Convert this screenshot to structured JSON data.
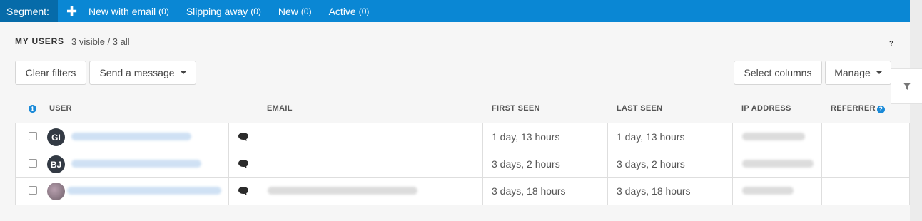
{
  "segment_bar": {
    "label": "Segment:",
    "add_symbol": "✚",
    "items": [
      {
        "label": "New with email",
        "count": "(0)"
      },
      {
        "label": "Slipping away",
        "count": "(0)"
      },
      {
        "label": "New",
        "count": "(0)"
      },
      {
        "label": "Active",
        "count": "(0)"
      }
    ]
  },
  "header": {
    "title": "MY USERS",
    "visible_count": "3 visible / 3 all",
    "help": "?"
  },
  "toolbar": {
    "clear_filters": "Clear filters",
    "send_message": "Send a message",
    "select_columns": "Select columns",
    "manage": "Manage"
  },
  "table": {
    "info_symbol": "i",
    "columns": {
      "user": "USER",
      "email": "EMAIL",
      "first_seen": "FIRST SEEN",
      "last_seen": "LAST SEEN",
      "ip_address": "IP ADDRESS",
      "referrer": "REFERRER",
      "referrer_help": "?"
    },
    "rows": [
      {
        "initials": "GI",
        "first_seen": "1 day, 13 hours",
        "last_seen": "1 day, 13 hours"
      },
      {
        "initials": "BJ",
        "first_seen": "3 days, 2 hours",
        "last_seen": "3 days, 2 hours"
      },
      {
        "initials": "",
        "first_seen": "3 days, 18 hours",
        "last_seen": "3 days, 18 hours"
      }
    ]
  },
  "icons": {
    "add": "plus-icon",
    "chat": "chat-bubble-icon",
    "filter": "filter-icon",
    "info": "info-icon",
    "help": "help-icon"
  },
  "colors": {
    "segment_bar": "#0a87d4",
    "segment_label_bg": "#066ba9",
    "accent": "#1a8ad8",
    "avatar": "#333a44"
  }
}
